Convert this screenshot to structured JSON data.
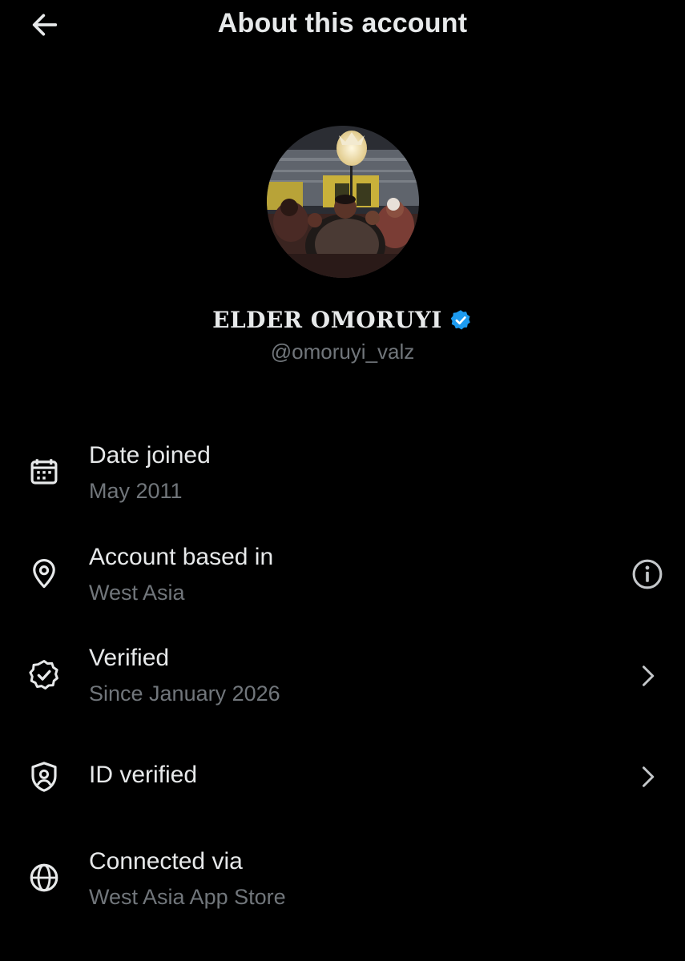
{
  "header": {
    "title": "About this account",
    "back_icon": "arrow-left-icon"
  },
  "profile": {
    "display_name": "ELDER OMORUYI",
    "handle": "@omoruyi_valz",
    "verified_badge_color": "#1d9bf0"
  },
  "rows": [
    {
      "icon": "calendar-icon",
      "label": "Date joined",
      "value": "May 2011",
      "trailing": ""
    },
    {
      "icon": "location-pin-icon",
      "label": "Account based in",
      "value": "West Asia",
      "trailing": "info-icon"
    },
    {
      "icon": "verified-badge-icon",
      "label": "Verified",
      "value": "Since January 2026",
      "trailing": "chevron-right-icon"
    },
    {
      "icon": "id-shield-icon",
      "label": "ID verified",
      "value": "",
      "trailing": "chevron-right-icon"
    },
    {
      "icon": "globe-icon",
      "label": "Connected via",
      "value": "West Asia App Store",
      "trailing": ""
    }
  ],
  "colors": {
    "background": "#000000",
    "primary_text": "#e7e9ea",
    "secondary_text": "#71767b",
    "accent": "#1d9bf0"
  }
}
